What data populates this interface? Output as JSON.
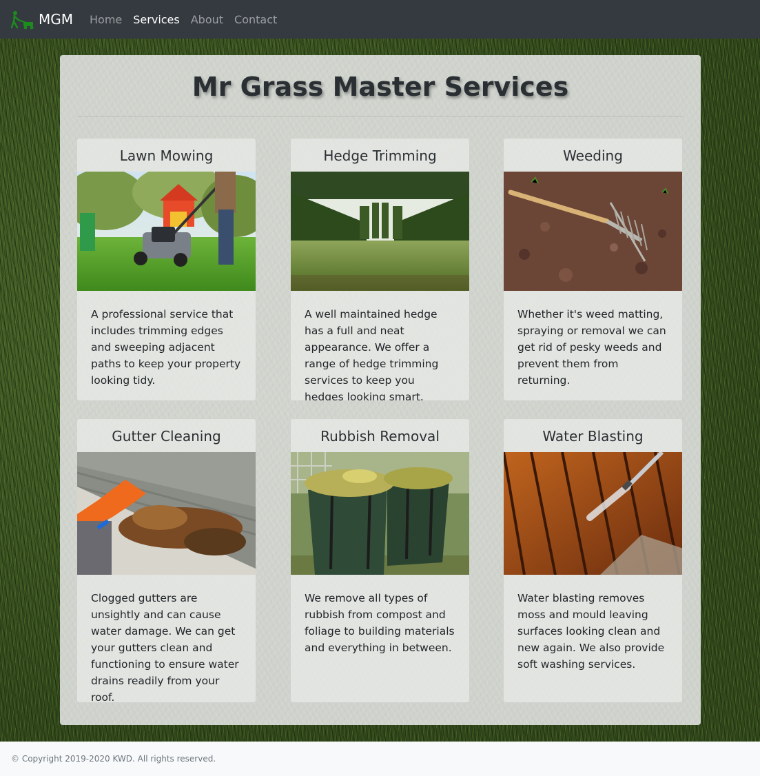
{
  "navbar": {
    "brand": "MGM",
    "links": [
      "Home",
      "Services",
      "About",
      "Contact"
    ],
    "active": "Services"
  },
  "main": {
    "title": "Mr Grass Master Services",
    "services": [
      {
        "title": "Lawn Mowing",
        "image": "lawn-mower-photo",
        "text": "A professional service that includes trimming edges and sweeping adjacent paths to keep your property looking tidy."
      },
      {
        "title": "Hedge Trimming",
        "image": "hedge-garden-photo",
        "text": "A well maintained hedge has a full and neat appearance. We offer a range of hedge trimming services to keep you hedges looking smart."
      },
      {
        "title": "Weeding",
        "image": "garden-rake-soil-photo",
        "text": "Whether it's weed matting, spraying or removal we can get rid of pesky weeds and prevent them from returning."
      },
      {
        "title": "Gutter Cleaning",
        "image": "gutter-leaves-photo",
        "text": "Clogged gutters are unsightly and can cause water damage. We can get your gutters clean and functioning to ensure water drains readily from your roof."
      },
      {
        "title": "Rubbish Removal",
        "image": "garden-waste-bags-photo",
        "text": "We remove all types of rubbish from compost and foliage to building materials and everything in between."
      },
      {
        "title": "Water Blasting",
        "image": "pressure-washing-deck-photo",
        "text": "Water blasting removes moss and mould leaving surfaces looking clean and new again. We also provide soft washing services."
      }
    ]
  },
  "footer": {
    "text": "© Copyright 2019-2020 KWD. All rights reserved."
  },
  "colors": {
    "navbar_bg": "#343a40",
    "brand_green": "#1e8b1e",
    "footer_bg": "#f8f9fa"
  }
}
